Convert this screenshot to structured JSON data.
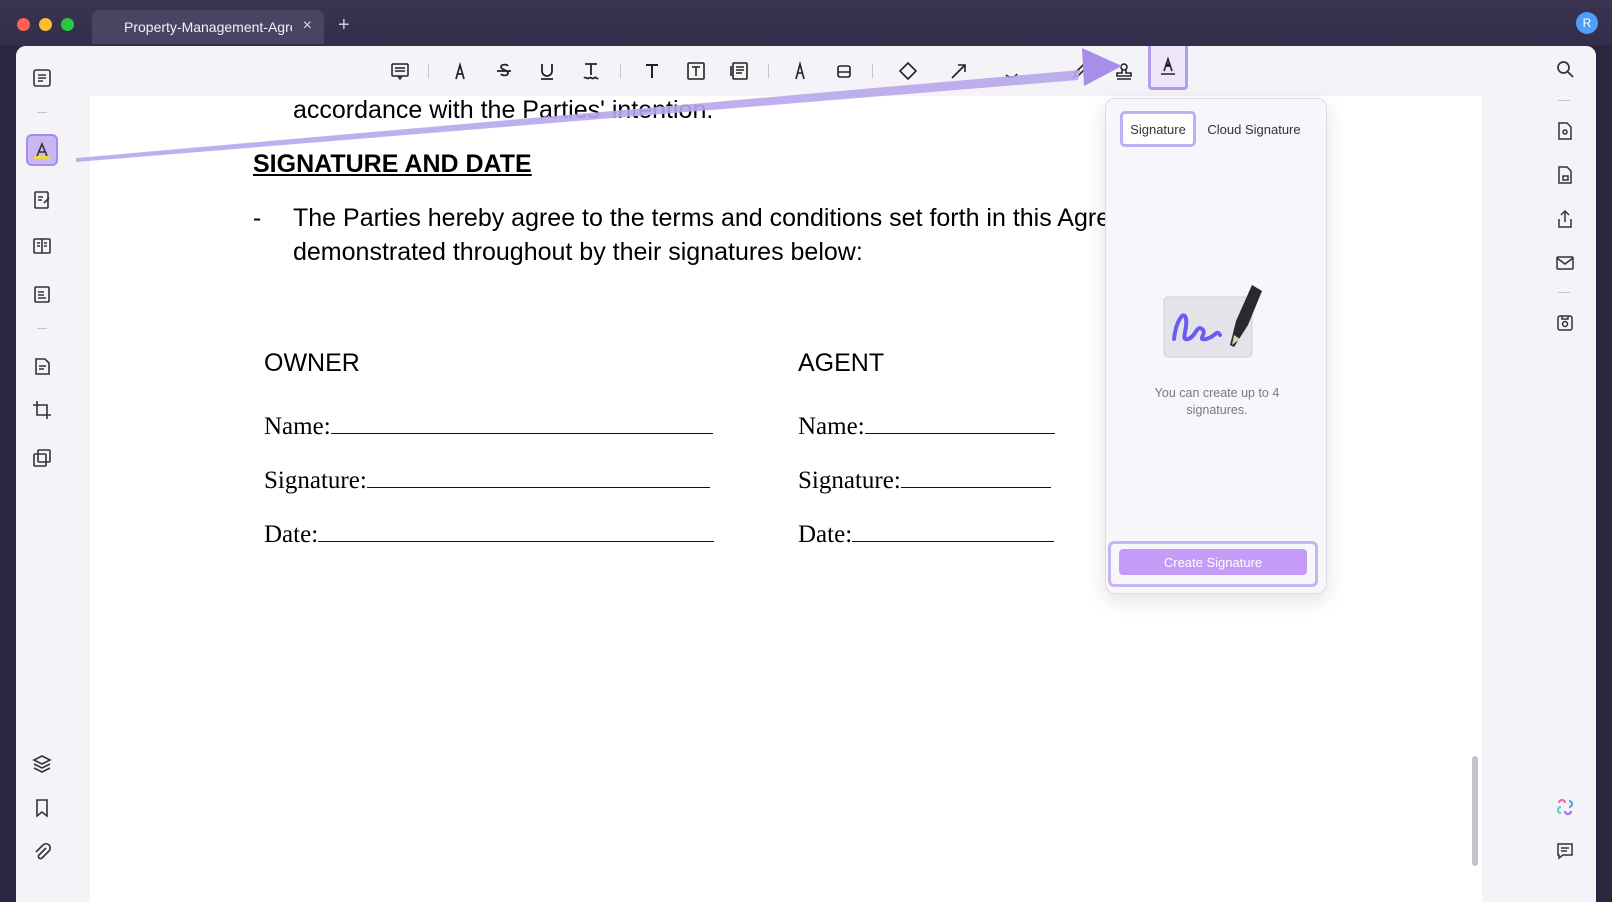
{
  "tab": {
    "title": "Property-Management-Agreement",
    "close": "×",
    "add": "+"
  },
  "user": {
    "initial": "R"
  },
  "document": {
    "line_top": "accordance with the Parties' intention.",
    "heading": "SIGNATURE AND DATE",
    "bullet_dash": "-",
    "para_line1": "The Parties hereby agree to the terms and conditions set forth in this Agreement and such is",
    "para_line2": "demonstrated throughout by their signatures below:",
    "owner": {
      "title": "OWNER",
      "name": "Name:",
      "signature": "Signature:",
      "date": "Date:"
    },
    "agent": {
      "title": "AGENT",
      "name": "Name:",
      "signature": "Signature:",
      "date": "Date:"
    }
  },
  "popover": {
    "tab_signature": "Signature",
    "tab_cloud": "Cloud Signature",
    "message": "You can create up to 4 signatures.",
    "create_button": "Create Signature"
  },
  "colors": {
    "accent": "#c49bf7",
    "highlight_border": "#b39bee",
    "arrow": "#b9a6ec"
  }
}
